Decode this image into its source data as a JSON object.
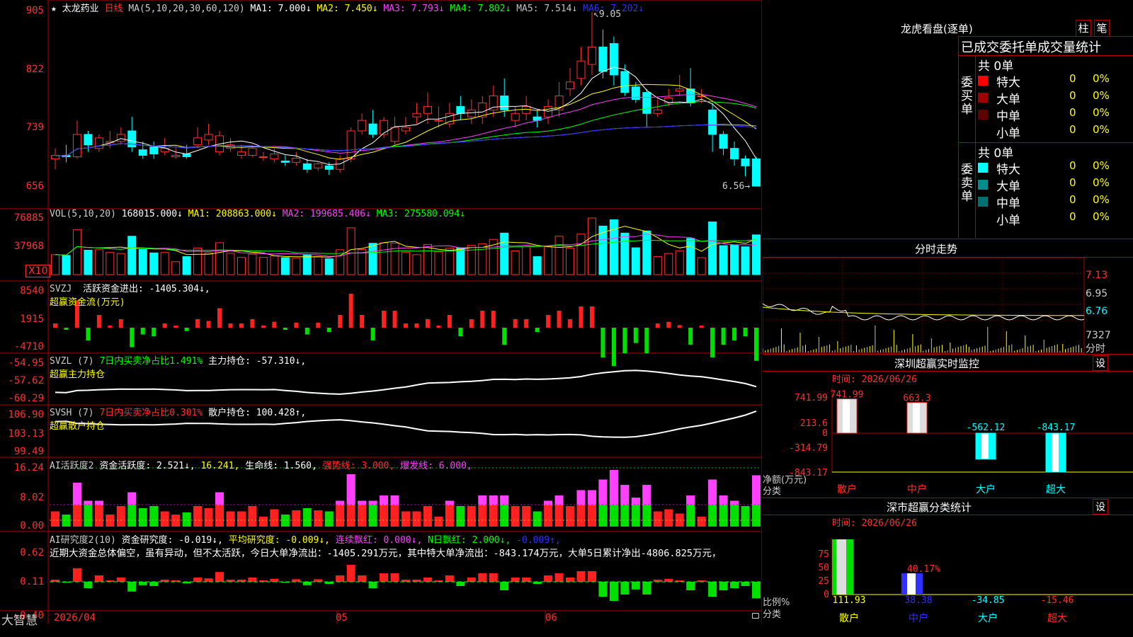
{
  "header": {
    "stock_name": "太龙药业",
    "period": "日线",
    "ma_title": "MA(5,10,20,30,60,120)",
    "ma": [
      {
        "label": "MA1:",
        "value": "7.000↓",
        "color": "#ffffff"
      },
      {
        "label": "MA2:",
        "value": "7.450↓",
        "color": "#ffff00"
      },
      {
        "label": "MA3:",
        "value": "7.793↓",
        "color": "#ff40ff"
      },
      {
        "label": "MA4:",
        "value": "7.802↓",
        "color": "#00ff00"
      },
      {
        "label": "MA5:",
        "value": "7.514↓",
        "color": "#c0c0c0"
      },
      {
        "label": "MA6:",
        "value": "7.202↓",
        "color": "#3030ff"
      }
    ],
    "price_high_mark": "9.05",
    "price_low_mark": "6.56"
  },
  "axes": {
    "price": [
      "905",
      "822",
      "739",
      "656"
    ],
    "vol": [
      "76885",
      "37968"
    ],
    "vol_unit": "X10",
    "svzj": [
      "8540",
      "1915",
      "-4710"
    ],
    "svzl": [
      "-54.95",
      "-57.62",
      "-60.29"
    ],
    "svsh": [
      "106.90",
      "103.13",
      "99.49"
    ],
    "ai1": [
      "16.24",
      "8.02",
      "0.00"
    ],
    "ai2": [
      "0.62",
      "0.11",
      "-0.40"
    ],
    "dates": [
      "2026/04",
      "05",
      "06"
    ]
  },
  "vol": {
    "title": "VOL(5,10,20)",
    "value": "168015.000↓",
    "ma": [
      {
        "label": "MA1:",
        "value": "208863.000↓",
        "color": "#ffff00"
      },
      {
        "label": "MA2:",
        "value": "199685.406↓",
        "color": "#ff40ff"
      },
      {
        "label": "MA3:",
        "value": "275580.094↓",
        "color": "#00ff00"
      }
    ]
  },
  "svzj": {
    "title": "SVZJ",
    "label": "活跃资金进出:",
    "value": "-1405.304↓,",
    "subtitle": "超赢资金流(万元)"
  },
  "svzl": {
    "title": "SVZL (7)",
    "label1": "7日内买卖净占比1.491%",
    "label2": "主力持仓:",
    "value": "-57.310↓,",
    "subtitle": "超赢主力持仓"
  },
  "svsh": {
    "title": "SVSH (7)",
    "label1": "7日内买卖净占比0.301%",
    "label2": "散户持仓:",
    "value": "100.428↑,",
    "subtitle": "超赢散户持仓"
  },
  "ai1": {
    "title": "AI活跃度2",
    "items": [
      {
        "text": "资金活跃度: 2.521↓,",
        "color": "#ffffff"
      },
      {
        "text": "16.241,",
        "color": "#ffff00"
      },
      {
        "text": "生命线: 1.560,",
        "color": "#ffffff"
      },
      {
        "text": "强势线: 3.000,",
        "color": "#ff3030"
      },
      {
        "text": "爆发线: 6.000,",
        "color": "#ff40ff"
      }
    ]
  },
  "ai2": {
    "title": "AI研究度2(10)",
    "items": [
      {
        "text": "资金研究度: -0.019↓,",
        "color": "#ffffff"
      },
      {
        "text": "平均研究度: -0.009↓,",
        "color": "#ffff00"
      },
      {
        "text": "连续飘红: 0.000↓,",
        "color": "#ff40ff"
      },
      {
        "text": "N日飘红: 2.000↓,",
        "color": "#00ff00"
      },
      {
        "text": "-0.009↑,",
        "color": "#3030ff"
      }
    ],
    "commentary": "近期大资金总体偏空，虽有异动，但不太活跃，今日大单净流出：-1405.291万元，其中特大单净流出：-843.174万元，大单5日累计净出-4806.825万元，"
  },
  "footer": {
    "brand": "大智慧"
  },
  "right": {
    "dragon_title": "龙虎看盘(逐单)",
    "btn_col": "柱",
    "btn_pen": "笔",
    "table_title": "已成交委托单成交量统计",
    "buy_group": "委买单",
    "sell_group": "委卖单",
    "buy_total": "共 0单",
    "sell_total": "共 0单",
    "buy_rows": [
      {
        "name": "特大",
        "count": "0",
        "pct": "0%",
        "color": "#ff0000"
      },
      {
        "name": "大单",
        "count": "0",
        "pct": "0%",
        "color": "#a00000"
      },
      {
        "name": "中单",
        "count": "0",
        "pct": "0%",
        "color": "#600000"
      },
      {
        "name": "小单",
        "count": "0",
        "pct": "0%",
        "color": ""
      }
    ],
    "sell_rows": [
      {
        "name": "特大",
        "count": "0",
        "pct": "0%",
        "color": "#00ffff"
      },
      {
        "name": "大单",
        "count": "0",
        "pct": "0%",
        "color": "#008c8c"
      },
      {
        "name": "中单",
        "count": "0",
        "pct": "0%",
        "color": "#007070"
      },
      {
        "name": "小单",
        "count": "0",
        "pct": "0%",
        "color": ""
      }
    ],
    "intraday_title": "分时走势",
    "intraday_y": [
      "7.13",
      "6.95",
      "6.76"
    ],
    "intraday_vol": "7327",
    "intraday_unit": "分时",
    "monitor_title": "深圳超赢实时监控",
    "settings": "设",
    "monitor_time": "时间: 2026/06/26",
    "monitor_y": [
      "741.99",
      "213.6",
      "0",
      "-314.79",
      "-843.17"
    ],
    "monitor_net_label": "净额(万元)",
    "monitor_cat_label": "分类",
    "monitor_bars": [
      {
        "cat": "散户",
        "value": 741.99,
        "label": "741.99",
        "cat_color": "#ff3030"
      },
      {
        "cat": "中户",
        "value": 663.3,
        "label": "663.3",
        "cat_color": "#ff3030"
      },
      {
        "cat": "大户",
        "value": -562.12,
        "label": "-562.12",
        "cat_color": "#00ffff"
      },
      {
        "cat": "超大",
        "value": -843.17,
        "label": "-843.17",
        "cat_color": "#00ffff"
      }
    ],
    "stat_title": "深市超赢分类统计",
    "stat_time": "时间: 2026/06/26",
    "stat_y": [
      "75",
      "50",
      "25",
      "0"
    ],
    "stat_ratio_label": "比例%",
    "stat_cat_label": "分类",
    "stat_bars": [
      {
        "cat": "散户",
        "value": 111.93,
        "label": "111.93",
        "color": "#ffff00"
      },
      {
        "cat": "中户",
        "value": 38.38,
        "label": "38.38",
        "color": "#3030ff",
        "top_label": "40.17%"
      },
      {
        "cat": "大户",
        "value": -34.85,
        "label": "-34.85",
        "color": "#00ffff"
      },
      {
        "cat": "超大",
        "value": -15.46,
        "label": "-15.46",
        "color": "#ff3030"
      }
    ]
  },
  "chart_data": {
    "type": "candlestick",
    "series_note": "daily OHLC",
    "open": [
      6.95,
      7.0,
      6.98,
      7.3,
      7.1,
      7.18,
      7.2,
      7.35,
      7.08,
      7.12,
      7.05,
      6.98,
      7.02,
      7.15,
      7.22,
      7.05,
      7.1,
      7.0,
      7.0,
      6.98,
      6.95,
      6.92,
      6.9,
      6.88,
      6.82,
      6.85,
      6.8,
      6.95,
      7.35,
      7.45,
      7.3,
      7.2,
      7.35,
      7.55,
      7.6,
      7.5,
      7.45,
      7.7,
      7.55,
      7.55,
      7.65,
      7.85,
      7.5,
      7.6,
      7.55,
      7.55,
      7.65,
      7.95,
      8.1,
      8.3,
      8.55,
      8.6,
      8.2,
      7.98,
      7.9,
      7.6,
      7.75,
      7.92,
      7.95,
      7.85,
      7.65,
      7.3,
      7.1,
      6.95,
      6.95
    ],
    "close": [
      7.0,
      6.98,
      7.3,
      7.15,
      7.25,
      7.2,
      7.3,
      7.12,
      7.0,
      7.02,
      7.1,
      7.0,
      6.98,
      7.25,
      7.3,
      7.28,
      7.15,
      7.05,
      7.1,
      6.98,
      7.02,
      6.9,
      6.96,
      6.8,
      6.88,
      6.8,
      6.95,
      7.35,
      7.5,
      7.3,
      7.5,
      7.4,
      7.4,
      7.6,
      7.7,
      7.5,
      7.6,
      7.6,
      7.65,
      7.75,
      7.85,
      7.65,
      7.6,
      7.7,
      7.5,
      7.7,
      7.85,
      8.05,
      8.35,
      8.55,
      8.2,
      8.15,
      7.9,
      7.8,
      7.6,
      7.65,
      7.82,
      7.95,
      7.75,
      7.85,
      7.3,
      7.1,
      6.95,
      6.85,
      6.56
    ],
    "high": [
      7.1,
      7.15,
      7.5,
      7.35,
      7.3,
      7.35,
      7.4,
      7.55,
      7.2,
      7.2,
      7.25,
      7.1,
      7.15,
      7.4,
      7.45,
      7.35,
      7.25,
      7.15,
      7.15,
      7.05,
      7.1,
      7.0,
      7.05,
      6.95,
      6.9,
      6.9,
      7.0,
      7.4,
      7.6,
      7.65,
      7.55,
      7.55,
      7.55,
      7.75,
      7.9,
      7.7,
      7.75,
      7.85,
      7.8,
      7.85,
      8.0,
      8.1,
      7.7,
      7.85,
      7.65,
      7.8,
      8.05,
      8.25,
      8.55,
      9.05,
      8.8,
      8.7,
      8.3,
      8.05,
      7.95,
      7.8,
      7.95,
      8.15,
      8.25,
      7.95,
      7.75,
      7.35,
      7.2,
      7.0,
      6.98
    ],
    "low": [
      6.8,
      6.9,
      6.95,
      7.05,
      7.05,
      7.1,
      7.15,
      7.05,
      6.95,
      6.95,
      7.0,
      6.95,
      6.95,
      7.1,
      7.15,
      7.0,
      7.05,
      6.95,
      6.98,
      6.92,
      6.9,
      6.85,
      6.85,
      6.75,
      6.78,
      6.72,
      6.75,
      6.9,
      7.3,
      7.25,
      7.25,
      7.15,
      7.3,
      7.45,
      7.45,
      7.4,
      7.4,
      7.5,
      7.45,
      7.45,
      7.55,
      7.55,
      7.4,
      7.5,
      7.4,
      7.45,
      7.55,
      7.85,
      8.0,
      8.15,
      8.1,
      8.0,
      7.85,
      7.75,
      7.4,
      7.55,
      7.7,
      7.85,
      7.7,
      7.75,
      7.05,
      7.0,
      6.85,
      6.7,
      6.56
    ]
  }
}
